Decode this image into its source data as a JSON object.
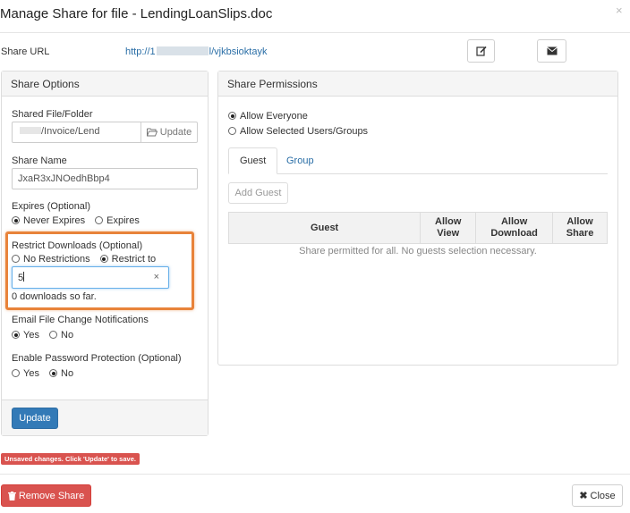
{
  "dialog": {
    "title": "Manage Share for file - LendingLoanSlips.doc",
    "close_glyph": "×"
  },
  "share_url": {
    "label": "Share URL",
    "link_prefix": "http://1",
    "link_suffix": "l/vjkbsioktayk"
  },
  "share_options": {
    "title": "Share Options",
    "file_folder": {
      "label": "Shared File/Folder",
      "value": "/Invoice/Lend",
      "update_label": "Update"
    },
    "share_name": {
      "label": "Share Name",
      "value": "JxaR3xJNOedhBbp4"
    },
    "expires": {
      "label": "Expires (Optional)",
      "options": [
        "Never Expires",
        "Expires"
      ],
      "selected": "Never Expires"
    },
    "restrict_downloads": {
      "label": "Restrict Downloads (Optional)",
      "options": [
        "No Restrictions",
        "Restrict to"
      ],
      "selected": "Restrict to",
      "value": "5",
      "clear_glyph": "×",
      "count_text": "0 downloads so far."
    },
    "email_notifications": {
      "label": "Email File Change Notifications",
      "options": [
        "Yes",
        "No"
      ],
      "selected": "Yes"
    },
    "password_protection": {
      "label": "Enable Password Protection (Optional)",
      "options": [
        "Yes",
        "No"
      ],
      "selected": "No"
    },
    "update_button": "Update"
  },
  "share_permissions": {
    "title": "Share Permissions",
    "scope_options": [
      "Allow Everyone",
      "Allow Selected Users/Groups"
    ],
    "scope_selected": "Allow Everyone",
    "tabs": [
      "Guest",
      "Group"
    ],
    "active_tab": "Guest",
    "add_guest_label": "Add Guest",
    "table": {
      "columns": [
        {
          "line1": "Guest",
          "line2": ""
        },
        {
          "line1": "Allow",
          "line2": "View"
        },
        {
          "line1": "Allow",
          "line2": "Download"
        },
        {
          "line1": "Allow",
          "line2": "Share"
        }
      ],
      "empty_message": "Share permitted for all. No guests selection necessary."
    }
  },
  "unsaved_notice": "Unsaved changes. Click 'Update' to save.",
  "footer": {
    "remove_label": "Remove Share",
    "close_label": "Close"
  },
  "colors": {
    "primary": "#337ab7",
    "danger": "#d9534f",
    "link": "#2a6ea6",
    "highlight": "#e8833a"
  }
}
